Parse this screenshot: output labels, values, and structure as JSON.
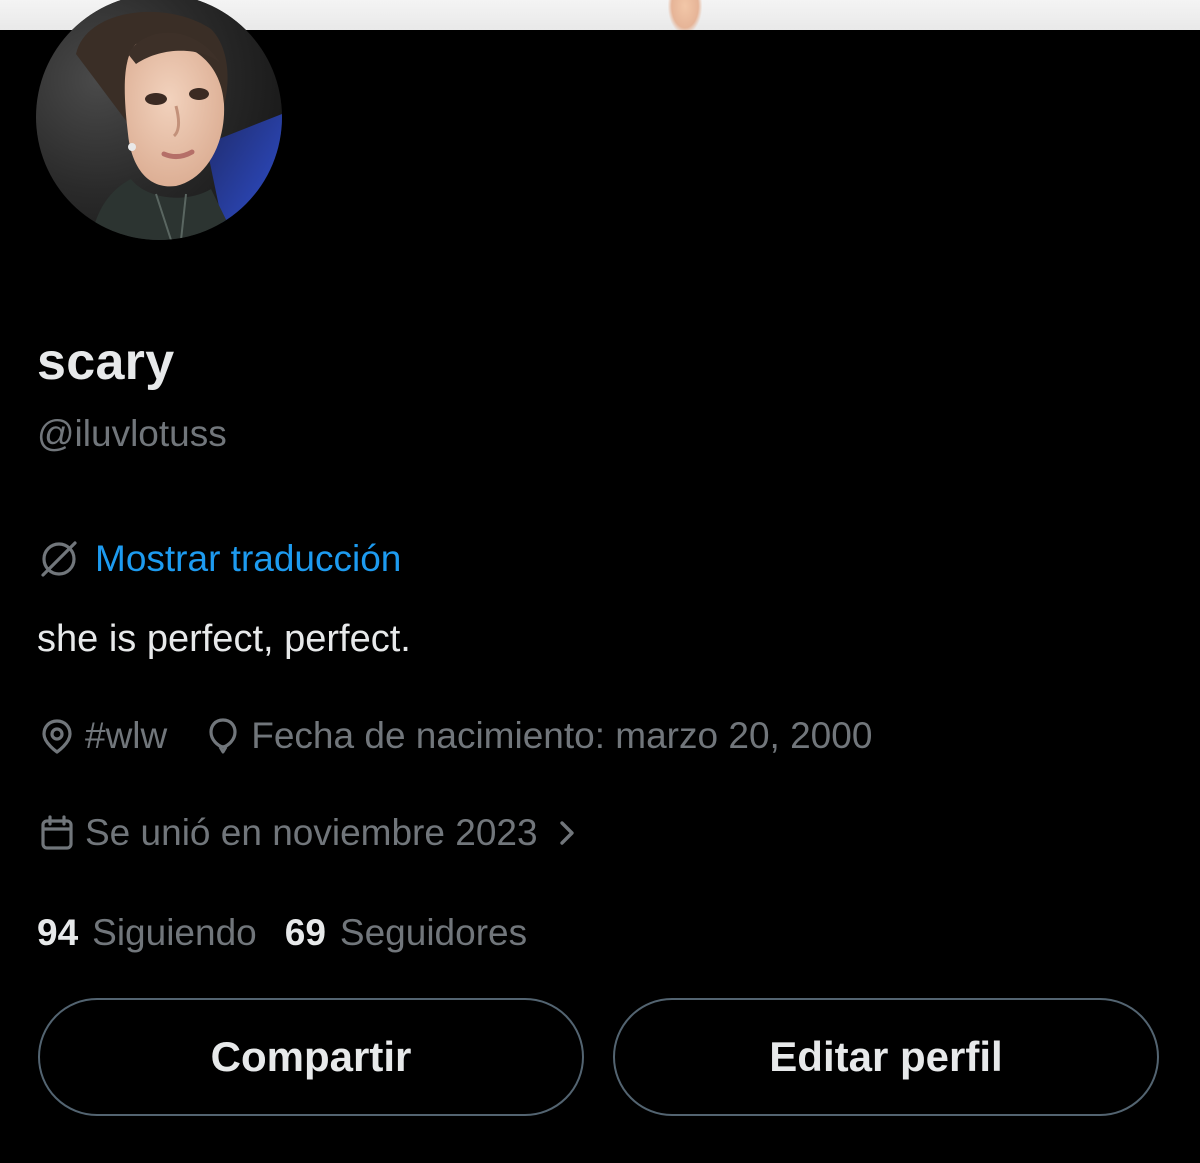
{
  "profile": {
    "display_name": "scary",
    "handle": "@iluvlotuss",
    "translate_label": "Mostrar traducción",
    "bio": "she is perfect, perfect.",
    "location": "#wlw",
    "birthdate": "Fecha de nacimiento: marzo 20, 2000",
    "joined": "Se unió en noviembre 2023"
  },
  "stats": {
    "following_count": "94",
    "following_label": "Siguiendo",
    "followers_count": "69",
    "followers_label": "Seguidores"
  },
  "actions": {
    "share_label": "Compartir",
    "edit_label": "Editar perfil"
  },
  "icons": {
    "translate": "globe-slash-icon",
    "location": "location-pin-icon",
    "birthdate": "balloon-icon",
    "joined": "calendar-icon",
    "joined_more": "chevron-right-icon"
  },
  "colors": {
    "background": "#000000",
    "primary_text": "#e7e9ea",
    "secondary_text": "#71767b",
    "link": "#1d9bf0",
    "button_border": "#536471"
  }
}
